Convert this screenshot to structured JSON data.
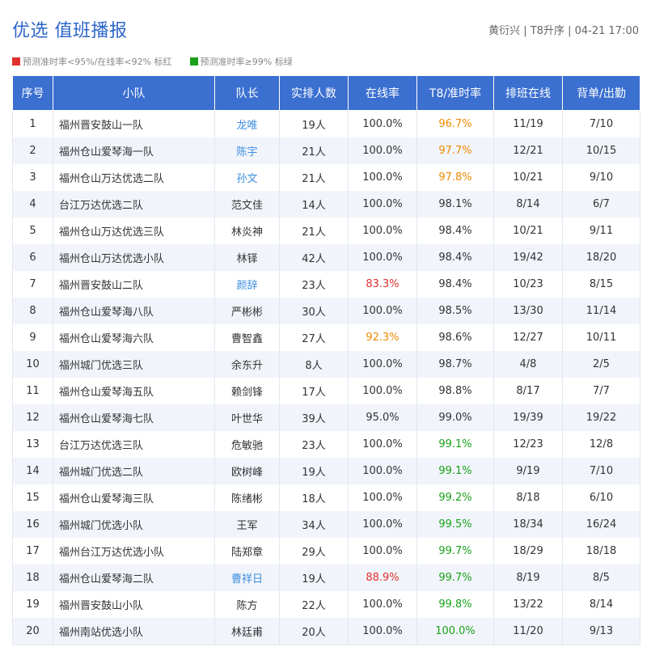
{
  "header": {
    "title": "优选 值班播报",
    "meta": "黄衍兴 | T8升序 | 04-21 17:00"
  },
  "legend": [
    {
      "label": "预测准时率<95%/在线率<92% 标红",
      "color": "#e0312e"
    },
    {
      "label": "预测准时率≥99% 标绿",
      "color": "#1aa31a"
    }
  ],
  "table": {
    "columns": [
      "序号",
      "小队",
      "队长",
      "实排人数",
      "在线率",
      "T8/准时率",
      "排班在线",
      "背单/出勤"
    ],
    "rows": [
      {
        "no": "1",
        "team": "福州晋安鼓山一队",
        "leader": "龙唯",
        "leader_color": "blue",
        "count": "19人",
        "online": "100.0%",
        "online_color": "",
        "t8": "96.7%",
        "t8_color": "orange",
        "sched": "11/19",
        "back": "7/10"
      },
      {
        "no": "2",
        "team": "福州仓山爱琴海一队",
        "leader": "陈宇",
        "leader_color": "blue",
        "count": "21人",
        "online": "100.0%",
        "online_color": "",
        "t8": "97.7%",
        "t8_color": "orange",
        "sched": "12/21",
        "back": "10/15"
      },
      {
        "no": "3",
        "team": "福州仓山万达优选二队",
        "leader": "孙文",
        "leader_color": "blue",
        "count": "21人",
        "online": "100.0%",
        "online_color": "",
        "t8": "97.8%",
        "t8_color": "orange",
        "sched": "10/21",
        "back": "9/10"
      },
      {
        "no": "4",
        "team": "台江万达优选二队",
        "leader": "范文佳",
        "leader_color": "",
        "count": "14人",
        "online": "100.0%",
        "online_color": "",
        "t8": "98.1%",
        "t8_color": "",
        "sched": "8/14",
        "back": "6/7"
      },
      {
        "no": "5",
        "team": "福州仓山万达优选三队",
        "leader": "林炎神",
        "leader_color": "",
        "count": "21人",
        "online": "100.0%",
        "online_color": "",
        "t8": "98.4%",
        "t8_color": "",
        "sched": "10/21",
        "back": "9/11"
      },
      {
        "no": "6",
        "team": "福州仓山万达优选小队",
        "leader": "林铎",
        "leader_color": "",
        "count": "42人",
        "online": "100.0%",
        "online_color": "",
        "t8": "98.4%",
        "t8_color": "",
        "sched": "19/42",
        "back": "18/20"
      },
      {
        "no": "7",
        "team": "福州晋安鼓山二队",
        "leader": "颜辞",
        "leader_color": "blue",
        "count": "23人",
        "online": "83.3%",
        "online_color": "red",
        "t8": "98.4%",
        "t8_color": "",
        "sched": "10/23",
        "back": "8/15"
      },
      {
        "no": "8",
        "team": "福州仓山爱琴海八队",
        "leader": "严彬彬",
        "leader_color": "",
        "count": "30人",
        "online": "100.0%",
        "online_color": "",
        "t8": "98.5%",
        "t8_color": "",
        "sched": "13/30",
        "back": "11/14"
      },
      {
        "no": "9",
        "team": "福州仓山爱琴海六队",
        "leader": "曹智鑫",
        "leader_color": "",
        "count": "27人",
        "online": "92.3%",
        "online_color": "orange",
        "t8": "98.6%",
        "t8_color": "",
        "sched": "12/27",
        "back": "10/11"
      },
      {
        "no": "10",
        "team": "福州城门优选三队",
        "leader": "余东升",
        "leader_color": "",
        "count": "8人",
        "online": "100.0%",
        "online_color": "",
        "t8": "98.7%",
        "t8_color": "",
        "sched": "4/8",
        "back": "2/5"
      },
      {
        "no": "11",
        "team": "福州仓山爱琴海五队",
        "leader": "赖剑锋",
        "leader_color": "",
        "count": "17人",
        "online": "100.0%",
        "online_color": "",
        "t8": "98.8%",
        "t8_color": "",
        "sched": "8/17",
        "back": "7/7"
      },
      {
        "no": "12",
        "team": "福州仓山爱琴海七队",
        "leader": "叶世华",
        "leader_color": "",
        "count": "39人",
        "online": "95.0%",
        "online_color": "",
        "t8": "99.0%",
        "t8_color": "",
        "sched": "19/39",
        "back": "19/22"
      },
      {
        "no": "13",
        "team": "台江万达优选三队",
        "leader": "危敏驰",
        "leader_color": "",
        "count": "23人",
        "online": "100.0%",
        "online_color": "",
        "t8": "99.1%",
        "t8_color": "green",
        "sched": "12/23",
        "back": "12/8"
      },
      {
        "no": "14",
        "team": "福州城门优选二队",
        "leader": "欧树峰",
        "leader_color": "",
        "count": "19人",
        "online": "100.0%",
        "online_color": "",
        "t8": "99.1%",
        "t8_color": "green",
        "sched": "9/19",
        "back": "7/10"
      },
      {
        "no": "15",
        "team": "福州仓山爱琴海三队",
        "leader": "陈绪彬",
        "leader_color": "",
        "count": "18人",
        "online": "100.0%",
        "online_color": "",
        "t8": "99.2%",
        "t8_color": "green",
        "sched": "8/18",
        "back": "6/10"
      },
      {
        "no": "16",
        "team": "福州城门优选小队",
        "leader": "王军",
        "leader_color": "",
        "count": "34人",
        "online": "100.0%",
        "online_color": "",
        "t8": "99.5%",
        "t8_color": "green",
        "sched": "18/34",
        "back": "16/24"
      },
      {
        "no": "17",
        "team": "福州台江万达优选小队",
        "leader": "陆郑章",
        "leader_color": "",
        "count": "29人",
        "online": "100.0%",
        "online_color": "",
        "t8": "99.7%",
        "t8_color": "green",
        "sched": "18/29",
        "back": "18/18"
      },
      {
        "no": "18",
        "team": "福州仓山爱琴海二队",
        "leader": "曹祥日",
        "leader_color": "blue",
        "count": "19人",
        "online": "88.9%",
        "online_color": "red",
        "t8": "99.7%",
        "t8_color": "green",
        "sched": "8/19",
        "back": "8/5"
      },
      {
        "no": "19",
        "team": "福州晋安鼓山小队",
        "leader": "陈方",
        "leader_color": "",
        "count": "22人",
        "online": "100.0%",
        "online_color": "",
        "t8": "99.8%",
        "t8_color": "green",
        "sched": "13/22",
        "back": "8/14"
      },
      {
        "no": "20",
        "team": "福州南站优选小队",
        "leader": "林廷甫",
        "leader_color": "",
        "count": "20人",
        "online": "100.0%",
        "online_color": "",
        "t8": "100.0%",
        "t8_color": "green",
        "sched": "11/20",
        "back": "9/13"
      }
    ]
  }
}
